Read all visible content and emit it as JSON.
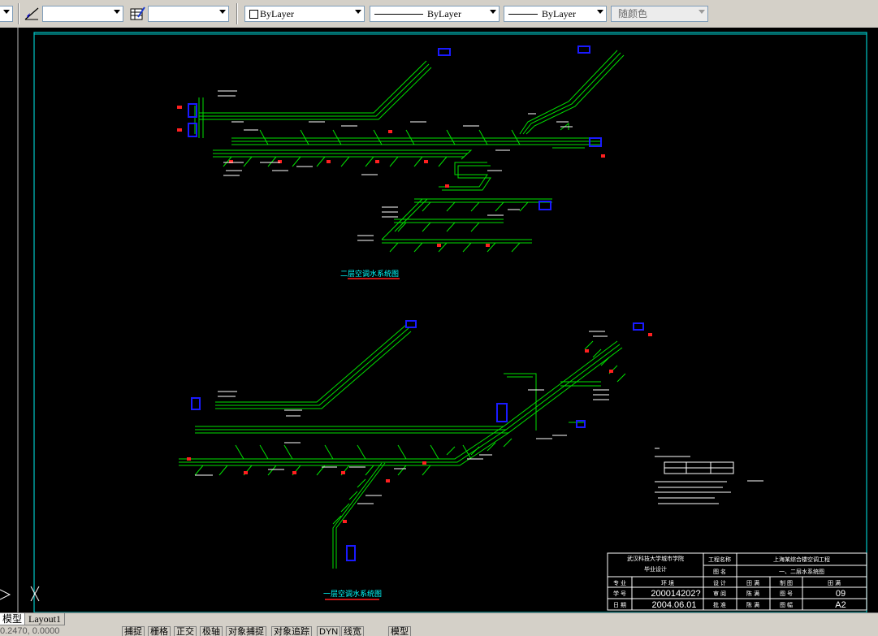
{
  "toolbar": {
    "layer_dropdown_value": "",
    "style_dropdown_value": "",
    "color_control": "ByLayer",
    "linetype_control": "ByLayer",
    "lineweight_control": "ByLayer",
    "plotstyle_control": "随颜色"
  },
  "drawing": {
    "upper_plan_title": "二层空调水系统图",
    "lower_plan_title": "一层空调水系统图",
    "title_block": {
      "school": "武汉科技大学城市学院",
      "design_type": "毕业设计",
      "project_name_label": "工程名称",
      "project_name": "上海某综合楼空调工程",
      "drawing_name_label": "图  名",
      "drawing_name": "一、二层水系统图",
      "role_major": "专  业",
      "major_value": "环  境",
      "role_design": "设  计",
      "design_value": "田  满",
      "role_drafter": "制  图",
      "drafter_value": "田  满",
      "role_check": "审  核",
      "check_value": "图  号",
      "id_label": "学  号",
      "student_id": "200014202?",
      "role_review": "审  阅",
      "review_value": "陈  满",
      "sheet_label": "图  号",
      "sheet_no": "09",
      "date_label": "日  期",
      "date_value": "2004.06.01",
      "role_approve": "批  准",
      "approve_value": "陈  满",
      "size_label": "图  幅",
      "sheet_size": "A2"
    }
  },
  "layout_tabs": {
    "model": "模型",
    "layout1": "Layout1"
  },
  "statusbar": {
    "coords": "0.2470, 0.0000",
    "snap": "捕捉",
    "grid": "栅格",
    "ortho": "正交",
    "polar": "极轴",
    "osnap": "对象捕捉",
    "otrack": "对象追踪",
    "dyn": "DYN",
    "lwt": "线宽",
    "model": "模型"
  },
  "colors": {
    "canvas_bg": "#000000",
    "pipe_green": "#00e000",
    "frame_cyan": "#00c8c8",
    "title_cyan": "#00ffff",
    "underline_red": "#ff2020",
    "unit_blue": "#1a1aff"
  }
}
